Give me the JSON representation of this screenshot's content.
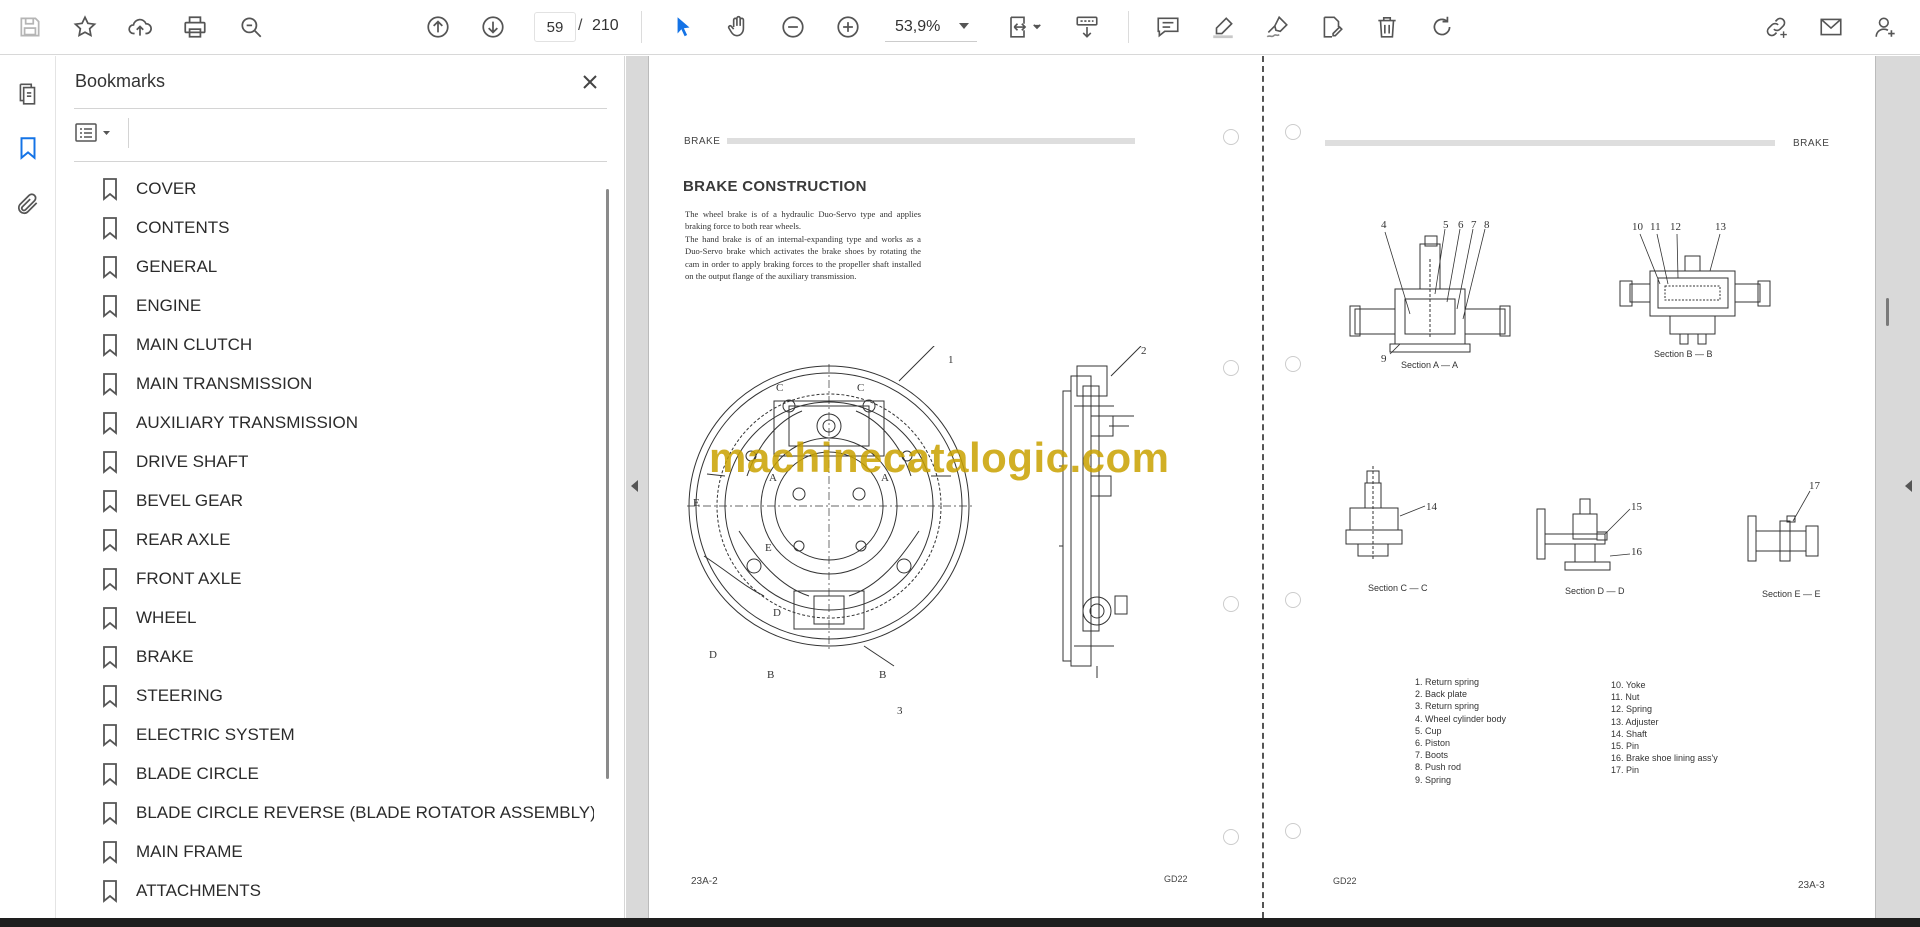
{
  "toolbar": {
    "current_page": "59",
    "page_separator": "/",
    "total_pages": "210",
    "zoom": "53,9%"
  },
  "bookmarks": {
    "title": "Bookmarks",
    "items": [
      "COVER",
      "CONTENTS",
      "GENERAL",
      "ENGINE",
      "MAIN CLUTCH",
      "MAIN TRANSMISSION",
      "AUXILIARY TRANSMISSION",
      "DRIVE SHAFT",
      "BEVEL GEAR",
      "REAR AXLE",
      "FRONT AXLE",
      "WHEEL",
      "BRAKE",
      "STEERING",
      "ELECTRIC SYSTEM",
      "BLADE CIRCLE",
      "BLADE CIRCLE REVERSE (BLADE ROTATOR ASSEMBLY)",
      "MAIN FRAME",
      "ATTACHMENTS"
    ]
  },
  "document": {
    "left_page": {
      "header": "BRAKE",
      "title": "BRAKE CONSTRUCTION",
      "paragraph1": "The wheel brake is of a hydraulic Duo-Servo type and applies braking force to both rear wheels.",
      "paragraph2": "The hand brake is of an internal-expanding type and works as a Duo-Servo brake which activates the brake shoes by rotating the cam in order to apply braking forces to the propeller shaft installed on the output flange of the auxiliary transmission.",
      "footer_left": "23A-2",
      "footer_right": "GD22",
      "figure_labels": [
        "1",
        "2",
        "3",
        "A",
        "A",
        "B",
        "B",
        "C",
        "C",
        "D",
        "D",
        "E",
        "E"
      ]
    },
    "right_page": {
      "header": "BRAKE",
      "footer_left": "GD22",
      "footer_right": "23A-3",
      "section_a": "Section A — A",
      "section_b": "Section B — B",
      "section_c": "Section C — C",
      "section_d": "Section D — D",
      "section_e": "Section E — E",
      "callouts_a": [
        "4",
        "5",
        "6",
        "7",
        "8",
        "9"
      ],
      "callouts_b": [
        "10",
        "11",
        "12",
        "13"
      ],
      "callout_c": "14",
      "callouts_d": [
        "15",
        "16"
      ],
      "callout_e": "17",
      "legend_left": [
        "1.  Return spring",
        "2.  Back plate",
        "3.  Return spring",
        "4.  Wheel cylinder body",
        "5.  Cup",
        "6.  Piston",
        "7.  Boots",
        "8.  Push rod",
        "9.  Spring"
      ],
      "legend_right": [
        "10.  Yoke",
        "11.  Nut",
        "12.  Spring",
        "13.  Adjuster",
        "14.  Shaft",
        "15.  Pin",
        "16.  Brake shoe lining ass'y",
        "17.  Pin"
      ]
    },
    "watermark": "machinecatalogic.com"
  },
  "icons": {
    "accent": "#1473e6"
  }
}
